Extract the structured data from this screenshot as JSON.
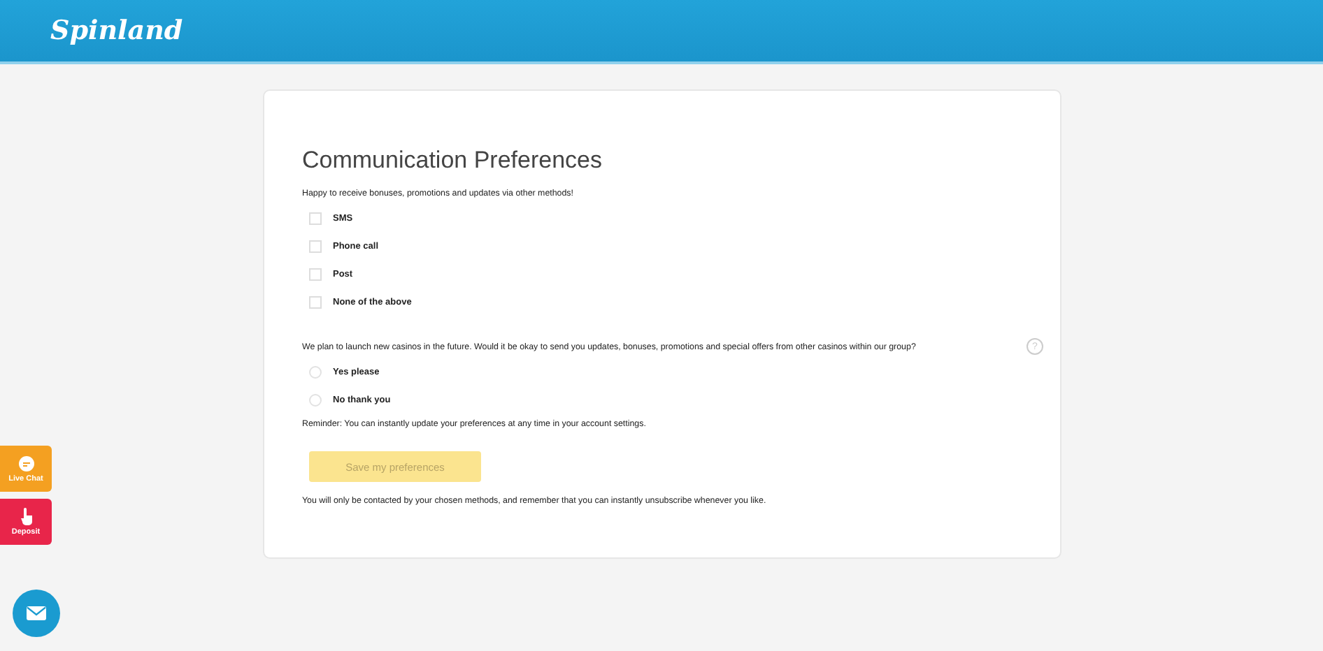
{
  "header": {
    "logo": "Spinland"
  },
  "form": {
    "title": "Communication Preferences",
    "intro": "Happy to receive bonuses, promotions and updates via other methods!",
    "methods": [
      {
        "label": "SMS",
        "checked": false
      },
      {
        "label": "Phone call",
        "checked": false
      },
      {
        "label": "Post",
        "checked": false
      },
      {
        "label": "None of the above",
        "checked": false
      }
    ],
    "question": "We plan to launch new casinos in the future. Would it be okay to send you updates, bonuses, promotions and special offers from other casinos within our group?",
    "help": "?",
    "answers": [
      {
        "label": "Yes please",
        "selected": false
      },
      {
        "label": "No thank you",
        "selected": false
      }
    ],
    "reminder": "Reminder: You can instantly update your preferences at any time in your account settings.",
    "save_button": {
      "label": "Save my preferences",
      "disabled": true
    },
    "footnote": "You will only be contacted by your chosen methods, and remember that you can instantly unsubscribe whenever you like."
  },
  "side_buttons": [
    {
      "label": "Live Chat",
      "kind": "chat"
    },
    {
      "label": "Deposit",
      "kind": "deposit"
    }
  ]
}
